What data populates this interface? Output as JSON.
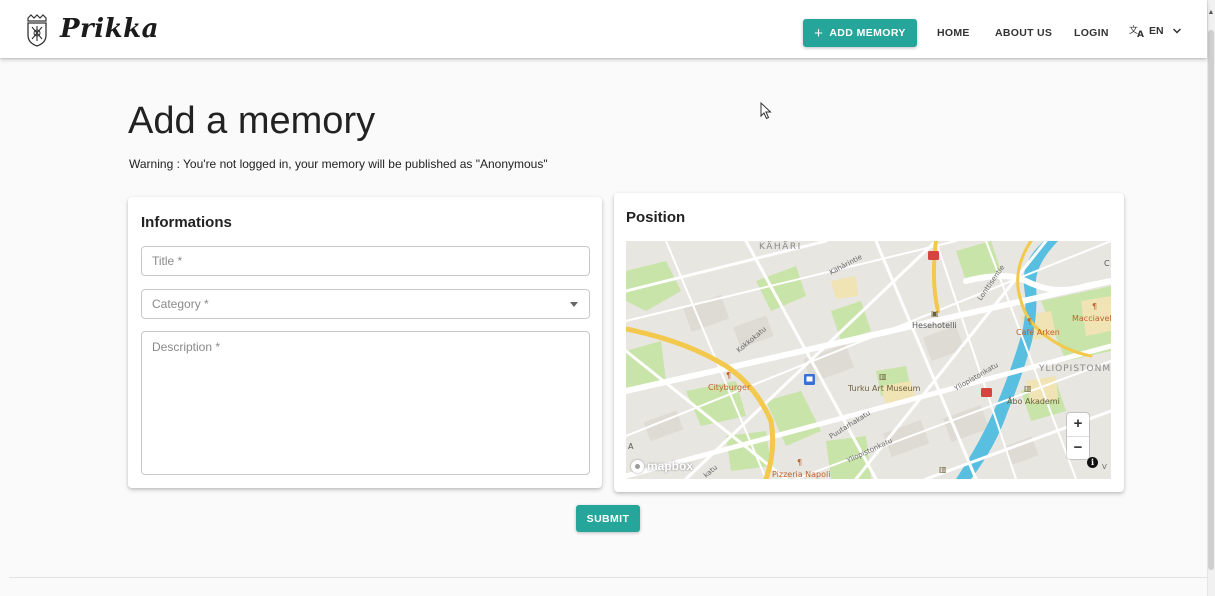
{
  "header": {
    "brand_name": "Prikka",
    "add_memory_label": "ADD MEMORY",
    "nav": [
      "HOME",
      "ABOUT US",
      "LOGIN"
    ],
    "language": "EN",
    "accent_color": "#26a69a"
  },
  "main": {
    "title": "Add a memory",
    "warning": "Warning : You're not logged in, your memory will be published as \"Anonymous\""
  },
  "informations": {
    "heading": "Informations",
    "title_placeholder": "Title *",
    "category_placeholder": "Category *",
    "description_placeholder": "Description *"
  },
  "position": {
    "heading": "Position",
    "map_attribution": "mapbox",
    "zoom_in": "+",
    "zoom_out": "−",
    "info_glyph": "i",
    "map_labels": {
      "kahari": "KÄHÄRI",
      "kaharintie": "Kähärintie",
      "lonttisentie": "Lonttisentie",
      "kokkokatu": "Kokkokatu",
      "hesehotelli": "Hesehotelli",
      "cafe_arken": "Café Arken",
      "macciavelli": "Macciavel",
      "cityburger": "Cityburger",
      "turku_art_museum": "Turku Art Museum",
      "yliopistonkatu_1": "Yliopistonkatu",
      "yliopistonmaki": "YLIOPISTONM",
      "abo_akademi": "Åbo Akademi",
      "puutarhakatu": "Puutarhakatu",
      "yliopistonkatu_2": "Yliopistonkatu",
      "pizzeria_napoli": "Pizzeria Napoli",
      "edge_katu": "katu",
      "edge_c": "C",
      "edge_a": "A",
      "edge_v": "V"
    }
  },
  "submit_label": "SUBMIT"
}
